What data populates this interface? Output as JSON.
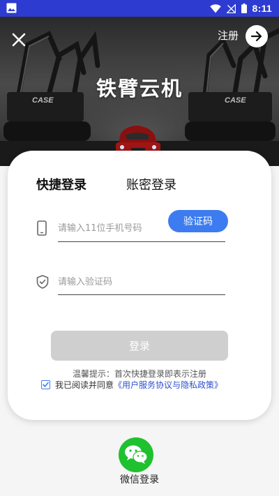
{
  "status_bar": {
    "time": "8:11"
  },
  "header": {
    "app_title": "铁臂云机",
    "register_label": "注册",
    "background_brand_text": "CASE"
  },
  "login_card": {
    "tabs": [
      {
        "label": "快捷登录",
        "active": true
      },
      {
        "label": "账密登录",
        "active": false
      }
    ],
    "phone_placeholder": "请输入11位手机号码",
    "code_placeholder": "请输入验证码",
    "get_code_label": "验证码",
    "login_label": "登录",
    "hint": "温馨提示：首次快捷登录即表示注册",
    "agree_prefix": "我已阅读并同意",
    "policy_link": "《用户服务协议与隐私政策》",
    "agree_checked": true
  },
  "wechat": {
    "label": "微信登录"
  },
  "colors": {
    "status_bar": "#2d3bd0",
    "accent_blue": "#3d7cf0",
    "link_blue": "#2f4fcf",
    "disabled_button": "#cfcfcf",
    "wechat_green": "#1fc12f"
  },
  "icons": [
    "gallery-icon",
    "wifi-icon",
    "signal-icon",
    "battery-icon",
    "close-icon",
    "arrow-right-icon",
    "phone-icon",
    "shield-check-icon",
    "checkbox-checked-icon",
    "wechat-icon"
  ]
}
